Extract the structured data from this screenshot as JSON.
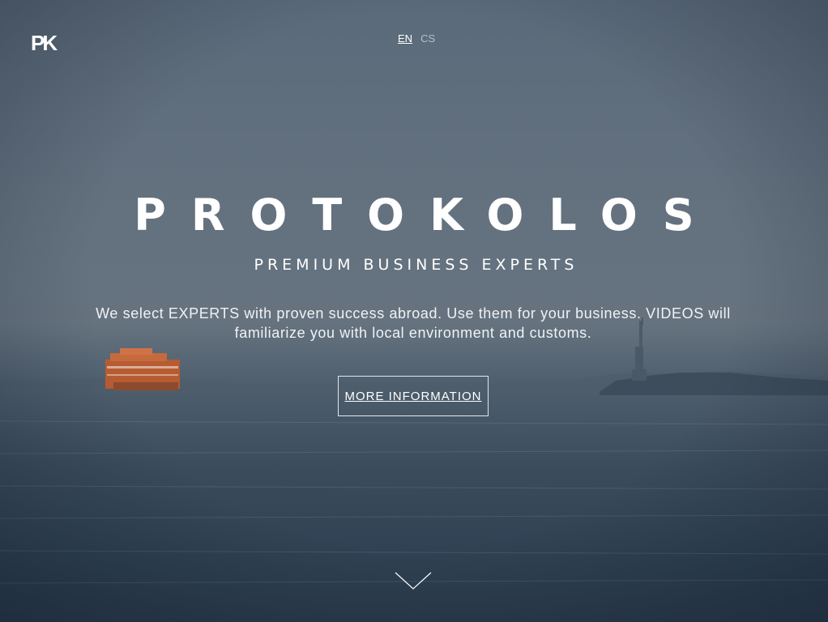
{
  "header": {
    "logo_text": "PK",
    "languages": [
      {
        "code": "EN",
        "active": true
      },
      {
        "code": "CS",
        "active": false
      }
    ]
  },
  "hero": {
    "title": "PROTOKOLOS",
    "subtitle": "PREMIUM BUSINESS EXPERTS",
    "tagline": "We select EXPERTS with proven success abroad. Use them for your business. VIDEOS will familiarize you with local environment and customs.",
    "cta_label": "MORE INFORMATION",
    "scroll_icon": "chevron-down-icon"
  },
  "colors": {
    "text": "#ffffff",
    "sky": "#63717f",
    "water": "#2f4152",
    "ferry": "#c8643a"
  }
}
